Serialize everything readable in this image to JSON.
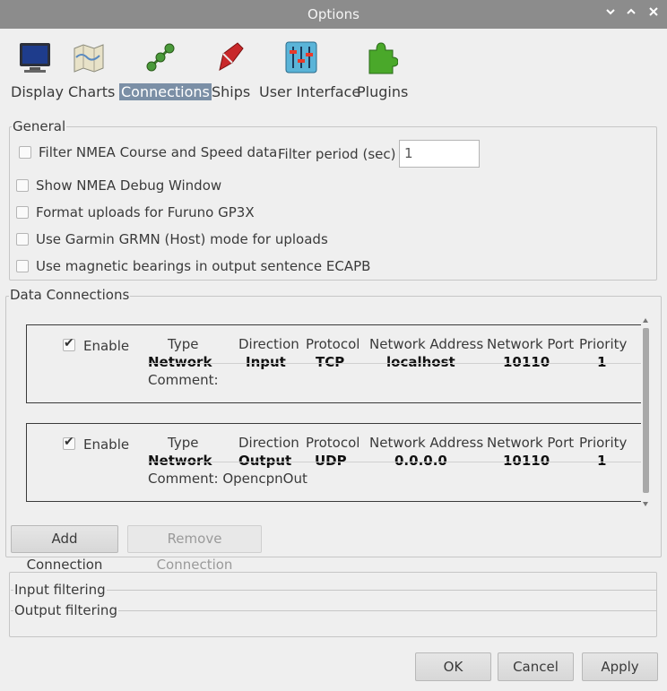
{
  "window": {
    "title": "Options"
  },
  "toolbar": [
    {
      "label": "Display",
      "icon": "display-icon"
    },
    {
      "label": "Charts",
      "icon": "charts-icon"
    },
    {
      "label": "Connections",
      "icon": "connections-icon",
      "selected": true
    },
    {
      "label": "Ships",
      "icon": "ships-icon"
    },
    {
      "label": "User Interface",
      "icon": "user-interface-icon"
    },
    {
      "label": "Plugins",
      "icon": "plugins-icon"
    }
  ],
  "general": {
    "title": "General",
    "filter_nmea_label": "Filter NMEA Course and Speed data",
    "filter_period_label": "Filter period (sec)",
    "filter_period_value": "1",
    "show_debug_label": "Show NMEA Debug Window",
    "furuno_label": "Format uploads for Furuno GP3X",
    "garmin_label": "Use Garmin GRMN (Host) mode for uploads",
    "magnetic_label": "Use magnetic bearings in output sentence ECAPB"
  },
  "data_connections": {
    "title": "Data Connections",
    "headers": {
      "enable": "Enable",
      "type": "Type",
      "direction": "Direction",
      "protocol": "Protocol",
      "address": "Network Address",
      "port": "Network Port",
      "priority": "Priority"
    },
    "connections": [
      {
        "enabled": true,
        "type": "Network",
        "direction": "Input",
        "protocol": "TCP",
        "address": "localhost",
        "port": "10110",
        "priority": "1",
        "comment": "Comment:"
      },
      {
        "enabled": true,
        "type": "Network",
        "direction": "Output",
        "protocol": "UDP",
        "address": "0.0.0.0",
        "port": "10110",
        "priority": "1",
        "comment": "Comment: OpencpnOut"
      }
    ],
    "add_button": "Add Connection",
    "remove_button": "Remove Connection"
  },
  "filtering": {
    "input_label": "Input filtering",
    "output_label": "Output filtering"
  },
  "dialog_buttons": {
    "ok": "OK",
    "cancel": "Cancel",
    "apply": "Apply"
  },
  "colors": {
    "titlebar": "#8c8c8c",
    "selection": "#7b8fa6"
  }
}
